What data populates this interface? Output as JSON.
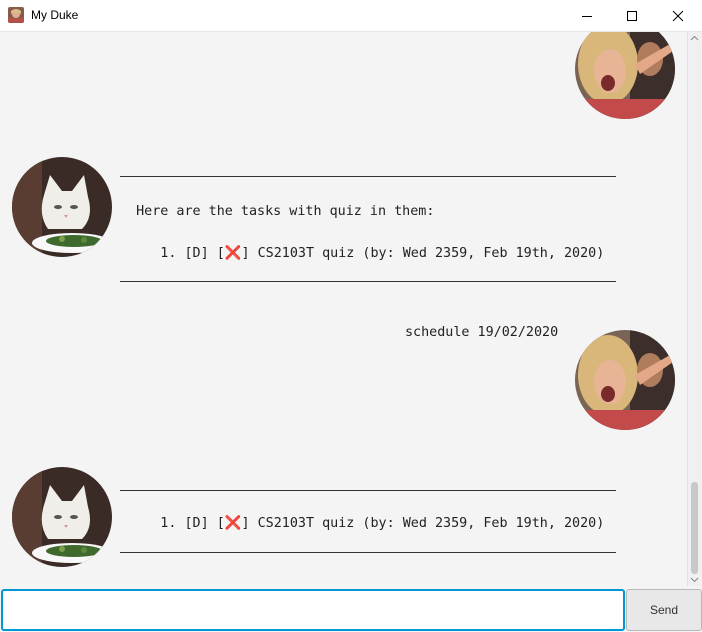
{
  "window": {
    "title": "My Duke",
    "controls": [
      "minimize-icon",
      "maximize-icon",
      "close-icon"
    ]
  },
  "messages": [
    {
      "sender": "user",
      "avatar": "user-avatar-yelling-woman",
      "text": ""
    },
    {
      "sender": "duke",
      "avatar": "duke-avatar-cat",
      "lines": [
        "____________________________________________________________",
        "  Here are the tasks with quiz in them:",
        "     1. [D] [❌] CS2103T quiz (by: Wed 2359, Feb 19th, 2020)",
        "____________________________________________________________"
      ]
    },
    {
      "sender": "user",
      "avatar": "user-avatar-yelling-woman",
      "text": "schedule 19/02/2020"
    },
    {
      "sender": "duke",
      "avatar": "duke-avatar-cat",
      "lines": [
        "____________________________________________________________",
        "     1. [D] [❌] CS2103T quiz (by: Wed 2359, Feb 19th, 2020)",
        "____________________________________________________________"
      ]
    }
  ],
  "input": {
    "value": "",
    "placeholder": ""
  },
  "send_button": {
    "label": "Send"
  },
  "colors": {
    "accent": "#0096d6",
    "background": "#f4f4f4"
  }
}
